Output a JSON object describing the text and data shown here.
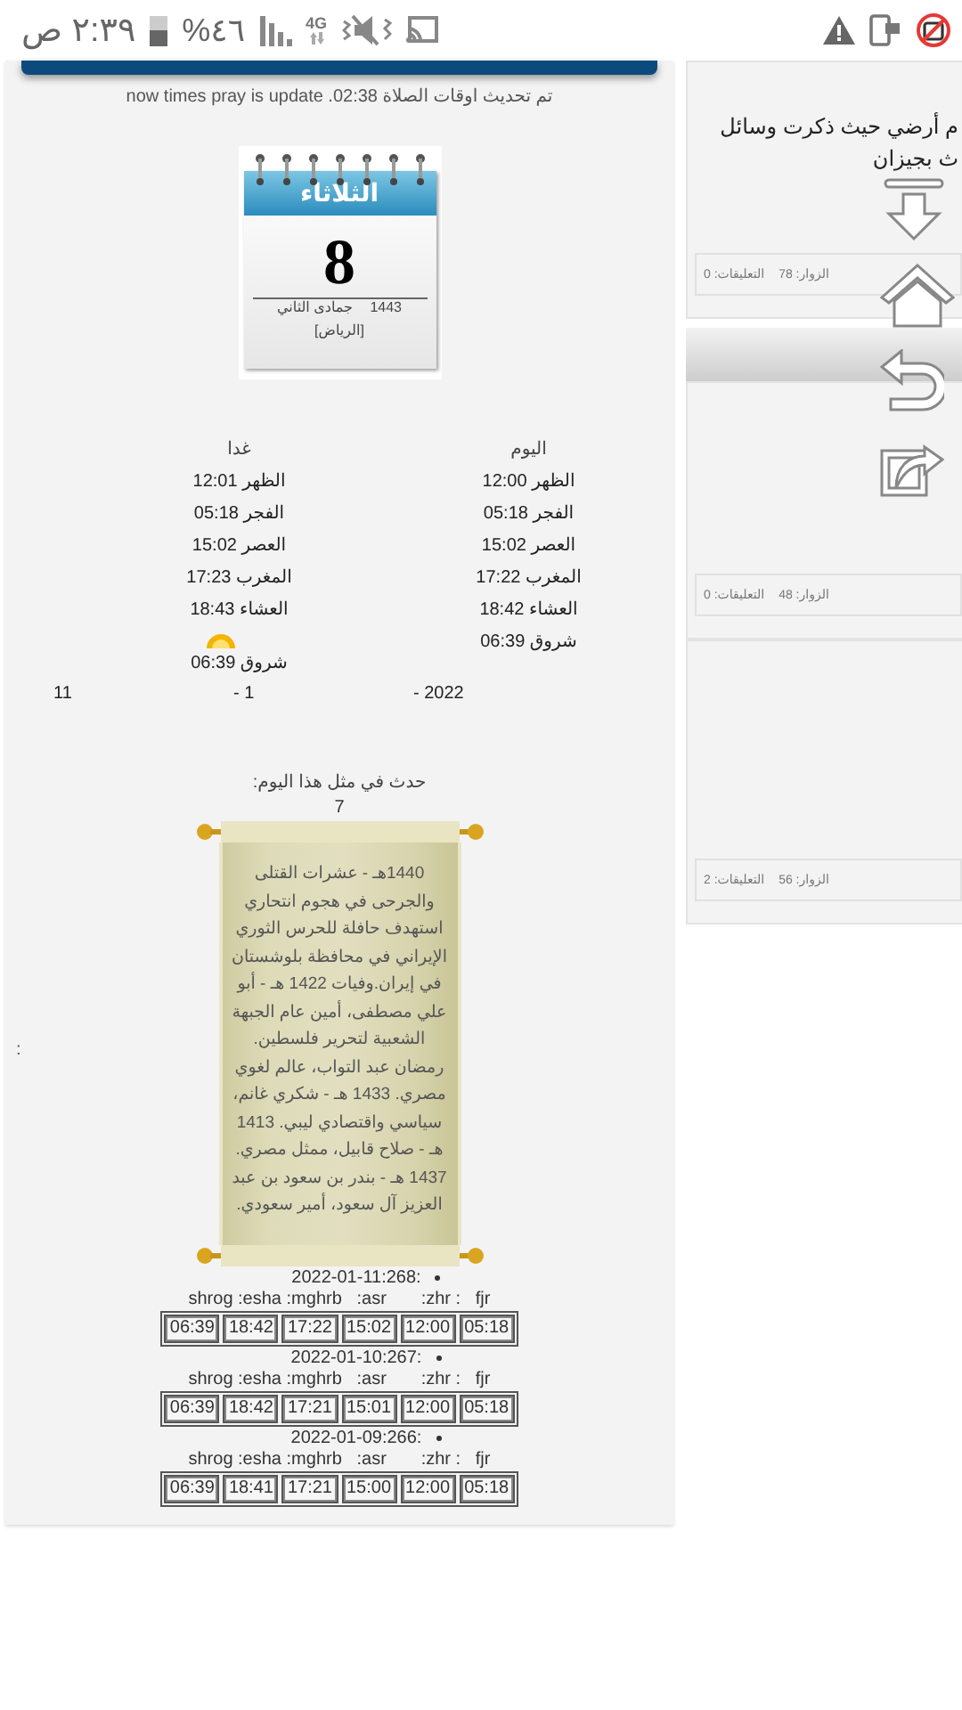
{
  "status_bar": {
    "time": "٢:٣٩ ص",
    "battery_percent": "%٤٦",
    "network": "4G"
  },
  "update_note": "now times pray is update .02:38 تم تحديث اوقات الصلاة",
  "calendar": {
    "weekday": "الثلاثاء",
    "day": "8",
    "month": "جمادى الثاني",
    "year": "1443",
    "city": "[الرياض]"
  },
  "prayer_times": [
    {
      "heading": "اليوم",
      "rows": [
        "الظهر 12:00",
        "الفجر 05:18",
        "العصر 15:02",
        "المغرب 17:22",
        "العشاء 18:42"
      ],
      "sunrise": "شروق 06:39",
      "sunrise_icon": false
    },
    {
      "heading": "غدا",
      "rows": [
        "الظهر 12:01",
        "الفجر 05:18",
        "العصر 15:02",
        "المغرب 17:23",
        "العشاء 18:43"
      ],
      "sunrise": "شروق 06:39",
      "sunrise_icon": true
    }
  ],
  "date_parts": [
    "- 2022",
    "- 1",
    "11"
  ],
  "on_this_day": {
    "heading": "حدث في مثل هذا اليوم:",
    "count": "7",
    "text": "1440هـ - عشرات القتلى والجرحى في هجوم انتحاري استهدف حافلة للحرس الثوري الإيراني في محافظة بلوشستان في إيران.وفيات 1422 هـ - أبو علي مصطفى، أمين عام الجبهة الشعبية لتحرير فلسطين. رمضان عبد التواب، عالم لغوي مصري. 1433 هـ - شكري غانم، سياسي واقتصادي ليبي. 1413 هـ - صلاح قابيل، ممثل مصري. 1437 هـ - بندر بن سعود بن عبد العزيز آل سعود، أمير سعودي."
  },
  "history": [
    {
      "label": "2022-01-11:268:",
      "headers": "shrog :esha :mghrb   :asr       :zhr :   fjr",
      "times": [
        "05:18",
        "12:00",
        "15:02",
        "17:22",
        "18:42",
        "06:39"
      ]
    },
    {
      "label": "2022-01-10:267:",
      "headers": "shrog :esha :mghrb   :asr       :zhr :   fjr",
      "times": [
        "05:18",
        "12:00",
        "15:01",
        "17:21",
        "18:42",
        "06:39"
      ]
    },
    {
      "label": "2022-01-09:266:",
      "headers": "shrog :esha :mghrb   :asr       :zhr :   fjr",
      "times": [
        "05:18",
        "12:00",
        "15:00",
        "17:21",
        "18:41",
        "06:39"
      ]
    }
  ],
  "side_mark": ":",
  "posts": [
    {
      "lines": [
        "م أرضي حيث ذكرت وسائل",
        "ث بجيزان"
      ],
      "visitors": "الزوار: 78",
      "comments": "التعليقات: 0"
    },
    {
      "visitors": "الزوار: 48",
      "comments": "التعليقات: 0"
    },
    {
      "visitors": "الزوار: 56",
      "comments": "التعليقات: 2"
    }
  ]
}
